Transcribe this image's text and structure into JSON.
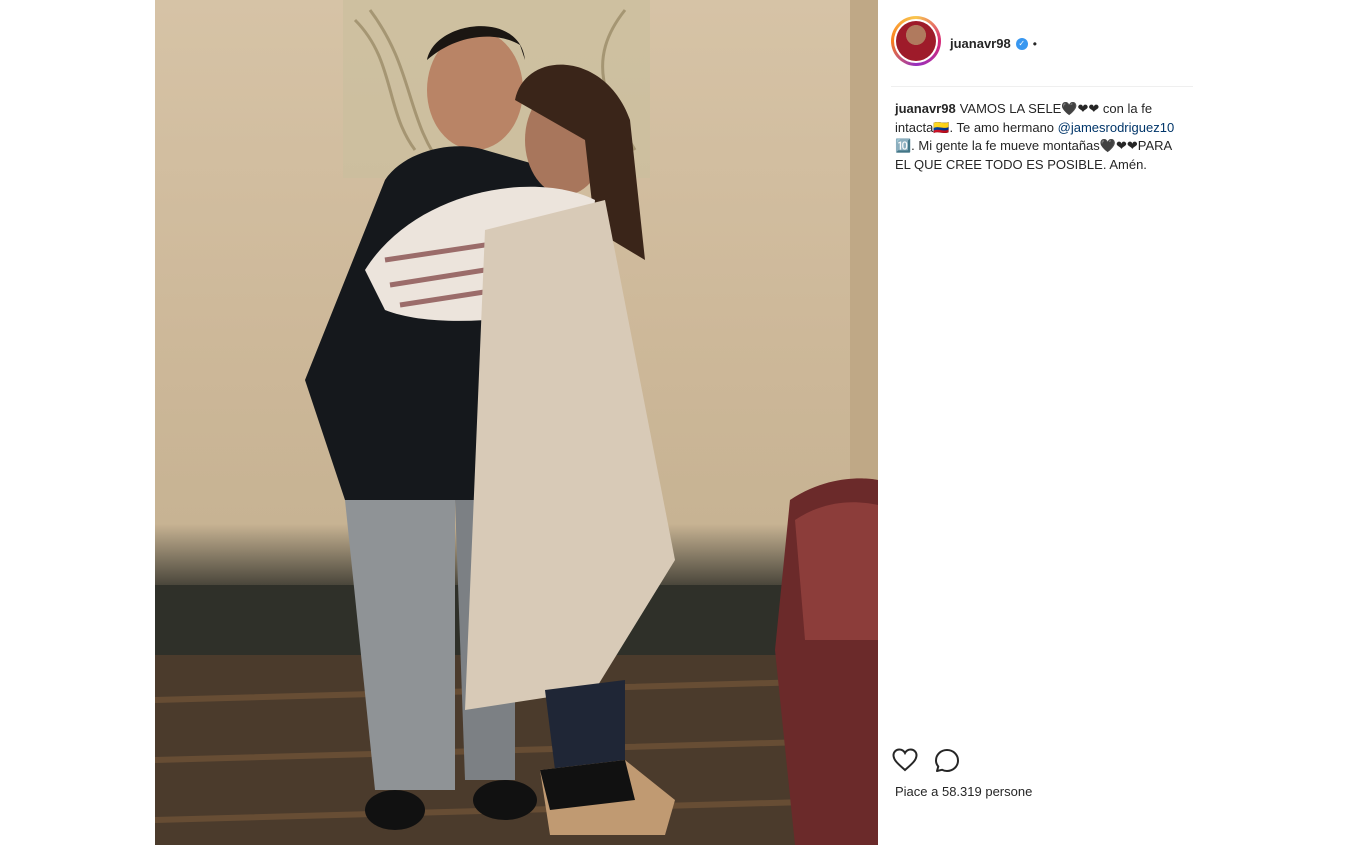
{
  "post": {
    "username": "juanavr98",
    "verified_symbol": "✓",
    "separator": "•",
    "caption": {
      "username": "juanavr98",
      "text_before_mention": "VAMOS LA SELE🖤❤❤ con la fe intacta🇨🇴. Te amo hermano ",
      "mention": "@jamesrodriguez10",
      "text_after_mention": " 🔟. Mi gente la fe mueve montañas🖤❤❤PARA EL QUE CREE TODO ES POSIBLE. Amén."
    },
    "likes_text": "Piace a 58.319 persone",
    "icons": {
      "like": "heart-icon",
      "comment": "comment-icon"
    },
    "colors": {
      "verified": "#3897f0",
      "text": "#262626",
      "mention": "#003569"
    }
  }
}
